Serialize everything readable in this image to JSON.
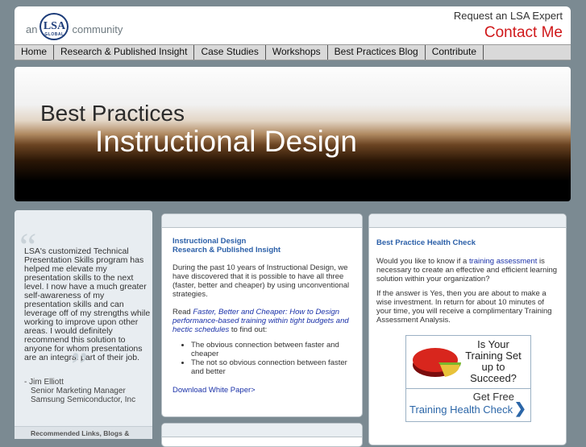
{
  "header": {
    "logo_prefix": "an",
    "logo_text": "LSA",
    "logo_sub": "GLOBAL",
    "logo_suffix": "community",
    "request_text": "Request an LSA Expert",
    "contact_text": "Contact Me"
  },
  "nav": {
    "items": [
      "Home",
      "Research & Published Insight",
      "Case Studies",
      "Workshops",
      "Best Practices Blog",
      "Contribute"
    ]
  },
  "banner": {
    "line1": "Best Practices",
    "line2": "Instructional Design"
  },
  "testimonial": {
    "quote": "LSA's customized Technical Presentation Skills program has helped me elevate my presentation skills to the next level. I now have a much greater self-awareness of my presentation skills and can leverage off of my strengths while working to improve upon other areas. I would definitely recommend this solution to anyone for whom presentations are an integral part of their job.",
    "author": "- Jim Elliott",
    "author_title": "Senior Marketing Manager",
    "author_company": "Samsung Semiconductor, Inc",
    "recommended": "Recommended Links, Blogs &"
  },
  "article": {
    "heading1": "Instructional Design",
    "heading2": "Research & Published Insight",
    "para1": "During the past 10 years of Instructional Design, we have discovered that it is possible to have all three (faster, better and cheaper) by using unconventional strategies.",
    "read_prefix": "Read ",
    "read_link": "Faster, Better and Cheaper: How to Design performance-based training within tight budgets and hectic schedules",
    "read_suffix": " to find out:",
    "bullets": [
      "The obvious connection between faster and cheaper",
      "The not so obvious connection between faster and better"
    ],
    "download": "Download White Paper>"
  },
  "health": {
    "heading": "Best Practice Health Check",
    "p1_prefix": "Would you like to know if a ",
    "p1_link": "training assessment",
    "p1_suffix": " is necessary to create an effective and efficient learning solution within your organization?",
    "p2": "If the answer is Yes, then you are about to make a wise investment. In return for about 10 minutes of your time, you will receive a complimentary Training Assessment Analysis.",
    "ad_q1": "Is Your",
    "ad_q2": "Training Set",
    "ad_q3": "up to",
    "ad_q4": "Succeed?",
    "ad_getfree": "Get Free",
    "ad_link": "Training Health Check",
    "ad_chevron": "❯"
  }
}
